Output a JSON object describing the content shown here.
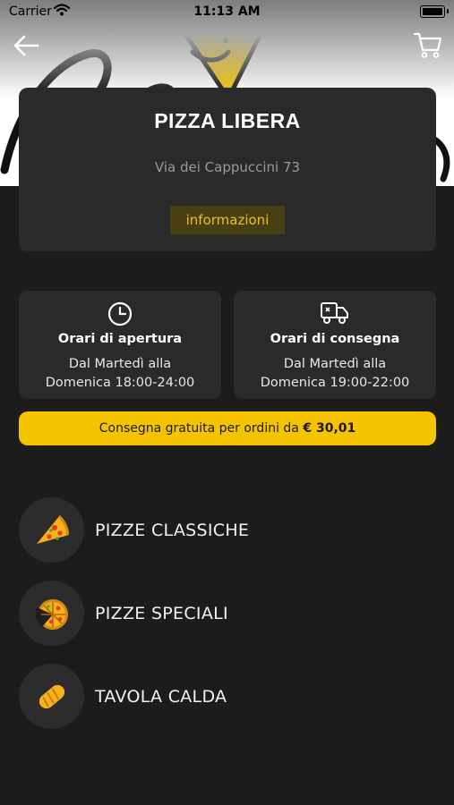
{
  "status_bar": {
    "carrier": "Carrier",
    "time": "11:13 AM"
  },
  "header": {
    "back_icon": "arrow-left-icon",
    "cart_icon": "cart-icon"
  },
  "restaurant": {
    "name": "PIZZA LIBERA",
    "address": "Via dei Cappuccini 73",
    "info_button_label": "informazioni"
  },
  "hours": [
    {
      "icon": "clock-icon",
      "title": "Orari di apertura",
      "line1": "Dal Martedì alla",
      "line2": "Domenica 18:00-24:00"
    },
    {
      "icon": "delivery-truck-icon",
      "title": "Orari di consegna",
      "line1": "Dal Martedì alla",
      "line2": "Domenica 19:00-22:00"
    }
  ],
  "delivery_banner": {
    "text": "Consegna gratuita per ordini da ",
    "amount": "€ 30,01"
  },
  "categories": [
    {
      "label": "PIZZE CLASSICHE",
      "icon": "pizza-slice-icon"
    },
    {
      "label": "PIZZE SPECIALI",
      "icon": "pizza-whole-icon"
    },
    {
      "label": "TAVOLA CALDA",
      "icon": "bread-icon"
    }
  ],
  "colors": {
    "accent": "#f5c400",
    "card": "#2a2a2a",
    "background": "#1c1c1c",
    "info_button_bg": "#4a3f12",
    "info_button_text": "#e6c31a"
  }
}
